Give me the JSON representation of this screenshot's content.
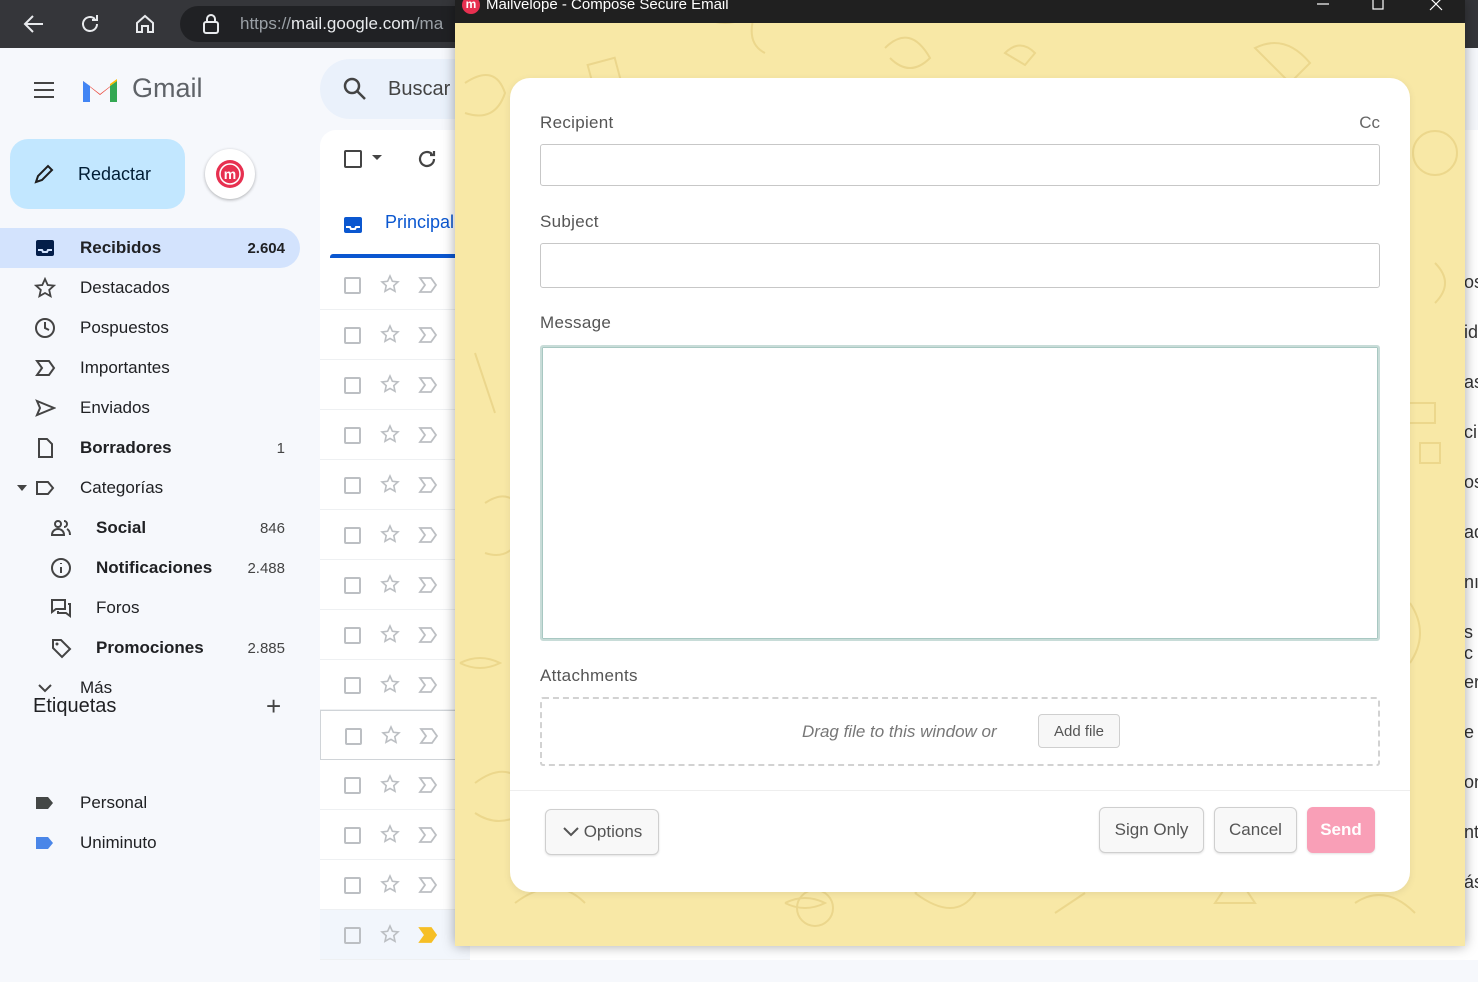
{
  "browser": {
    "url_prefix": "https://",
    "url_host": "mail.google.com",
    "url_rest": "/ma"
  },
  "gmail": {
    "logo_text": "Gmail",
    "compose_label": "Redactar",
    "search_placeholder": "Buscar",
    "tab_primary": "Principal",
    "labels_title": "Etiquetas",
    "nav": [
      {
        "label": "Recibidos",
        "count": "2.604"
      },
      {
        "label": "Destacados",
        "count": ""
      },
      {
        "label": "Pospuestos",
        "count": ""
      },
      {
        "label": "Importantes",
        "count": ""
      },
      {
        "label": "Enviados",
        "count": ""
      },
      {
        "label": "Borradores",
        "count": "1"
      },
      {
        "label": "Categorías",
        "count": ""
      },
      {
        "label": "Social",
        "count": "846"
      },
      {
        "label": "Notificaciones",
        "count": "2.488"
      },
      {
        "label": "Foros",
        "count": ""
      },
      {
        "label": "Promociones",
        "count": "2.885"
      },
      {
        "label": "Más",
        "count": ""
      }
    ],
    "labels": [
      {
        "label": "Personal",
        "color": "#444746"
      },
      {
        "label": "Uniminuto",
        "color": "#4a86e8"
      }
    ],
    "right_peek": [
      "os",
      "id",
      "as",
      "ci",
      "os",
      "ad",
      "nı",
      "s c",
      "er",
      "e",
      "on",
      "nt",
      "ás"
    ]
  },
  "mailvelope": {
    "window_title": "Mailvelope - Compose Secure Email",
    "recipient_label": "Recipient",
    "cc_label": "Cc",
    "subject_label": "Subject",
    "message_label": "Message",
    "attachments_label": "Attachments",
    "drop_text": "Drag file to this window or",
    "add_file_label": "Add file",
    "options_label": "Options",
    "sign_only_label": "Sign Only",
    "cancel_label": "Cancel",
    "send_label": "Send",
    "colors": {
      "background": "#f8e8a6",
      "send": "#f99fb7",
      "brand": "#e73050"
    }
  }
}
